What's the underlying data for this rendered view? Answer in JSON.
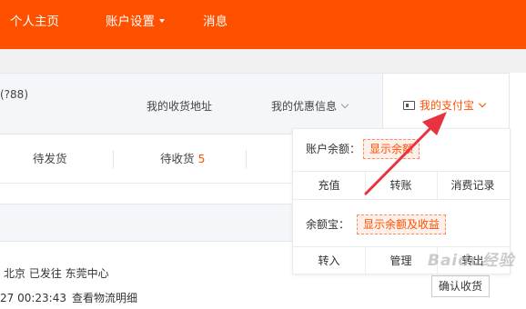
{
  "nav": {
    "home": "个人主页",
    "account_settings": "账户设置",
    "messages": "消息"
  },
  "header": {
    "truncated_text": "(?88)",
    "address_link": "我的收货地址",
    "coupon_link": "我的优惠信息",
    "alipay_link": "我的支付宝"
  },
  "status": {
    "to_ship": "待发货",
    "to_receive": "待收货",
    "to_receive_count": "5"
  },
  "order": {
    "location_line": "北京 已发往 东莞中心",
    "time": "27 00:23:43",
    "logistics_link": "查看物流明细",
    "confirm_button": "确认收货"
  },
  "dropdown": {
    "balance_label": "账户余额：",
    "show_balance": "显示余额",
    "actions_1": [
      "充值",
      "转账",
      "消费记录"
    ],
    "yuebao_label": "余额宝：",
    "show_yuebao": "显示余额及收益",
    "actions_2": [
      "转入",
      "管理",
      "转出"
    ]
  },
  "watermark": "Baidu经验",
  "colors": {
    "brand_orange": "#ff5000",
    "arrow_red": "#e8323f"
  }
}
